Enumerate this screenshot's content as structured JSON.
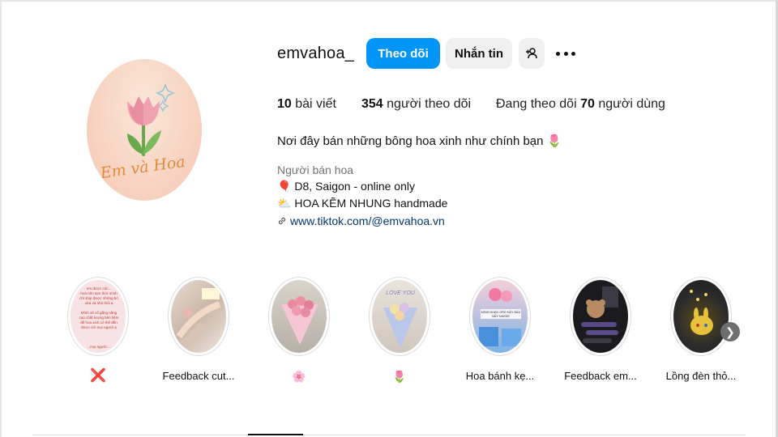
{
  "profile": {
    "username": "emvahoa_",
    "avatar_logo_text": "Em và Hoa"
  },
  "actions": {
    "follow_label": "Theo dõi",
    "message_label": "Nhắn tin",
    "add_user_icon": "add-user-icon",
    "more_icon": "more-options-icon"
  },
  "stats": {
    "posts_count": "10",
    "posts_label": "bài viết",
    "followers_count": "354",
    "followers_label": "người theo dõi",
    "following_prefix": "Đang theo dõi",
    "following_count": "70",
    "following_suffix": "người dùng"
  },
  "bio": {
    "headline": "Nơi đây bán những bông hoa xinh như chính bạn",
    "headline_emoji": "🌷",
    "category": "Người bán hoa",
    "line1_icon": "🎈",
    "line1": "D8, Saigon - online only",
    "line2_icon": "⛅",
    "line2": "HOA KẼM NHUNG handmade",
    "link": "www.tiktok.com/@emvahoa.vn"
  },
  "highlights": [
    {
      "label": "❌",
      "thumb": "text-note"
    },
    {
      "label": "Feedback cut...",
      "thumb": "feedback-photo"
    },
    {
      "label": "🌸",
      "thumb": "pink-bouquet"
    },
    {
      "label": "🌷",
      "thumb": "love-you-bouquet"
    },
    {
      "label": "Hoa bánh kẹ...",
      "thumb": "candy-bouquet"
    },
    {
      "label": "Feedback em...",
      "thumb": "chat-screenshot"
    },
    {
      "label": "Lồng đèn thỏ...",
      "thumb": "rabbit-lantern"
    }
  ],
  "highlight_texts": {
    "note": "em được các... hoa nên tạm thời mình chỉ ship được những bó vừa và nhỏ thôi ạ. Mình sẽ cố gắng nâng cao chất lượng bên tiệm để hoa xinh có thể đến được với mọi người ạ",
    "love_you": "LOVE YOU",
    "candy": "MÌNH NHẬN ORD NẤY BẦU NẤY NHEEE"
  },
  "colors": {
    "accent": "#0095f6",
    "secondary_button": "#efefef",
    "link": "#00376b",
    "muted": "#737373"
  }
}
